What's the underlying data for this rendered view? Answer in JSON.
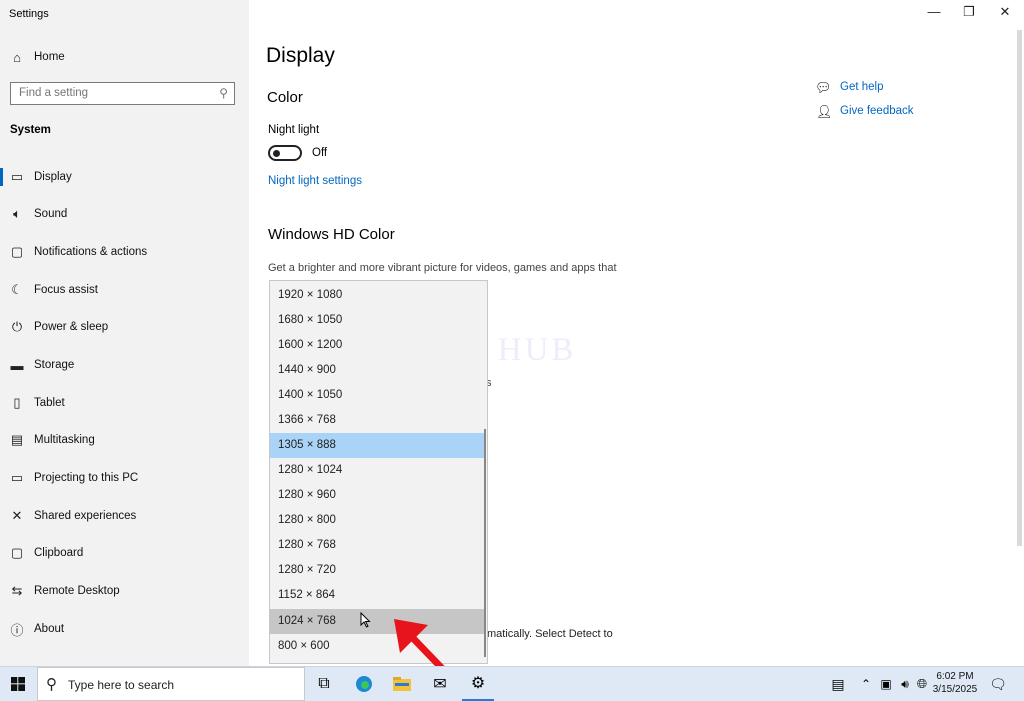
{
  "window": {
    "title": "Settings",
    "minimize": "—",
    "maximize": "❐",
    "close": "✕"
  },
  "sidebar": {
    "home": "Home",
    "search_placeholder": "Find a setting",
    "section": "System",
    "items": [
      {
        "label": "Display",
        "icon": "monitor-icon"
      },
      {
        "label": "Sound",
        "icon": "speaker-icon"
      },
      {
        "label": "Notifications & actions",
        "icon": "notification-icon"
      },
      {
        "label": "Focus assist",
        "icon": "moon-icon"
      },
      {
        "label": "Power & sleep",
        "icon": "power-icon"
      },
      {
        "label": "Storage",
        "icon": "storage-icon"
      },
      {
        "label": "Tablet",
        "icon": "tablet-icon"
      },
      {
        "label": "Multitasking",
        "icon": "multitasking-icon"
      },
      {
        "label": "Projecting to this PC",
        "icon": "projector-icon"
      },
      {
        "label": "Shared experiences",
        "icon": "share-icon"
      },
      {
        "label": "Clipboard",
        "icon": "clipboard-icon"
      },
      {
        "label": "Remote Desktop",
        "icon": "remote-icon"
      },
      {
        "label": "About",
        "icon": "info-icon"
      }
    ]
  },
  "main": {
    "page_title": "Display",
    "color_heading": "Color",
    "night_light_label": "Night light",
    "night_light_state": "Off",
    "night_light_settings": "Night light settings",
    "hd_heading": "Windows HD Color",
    "hd_desc": "Get a brighter and more vibrant picture for videos, games and apps that",
    "partial_line": "matically. Select Detect to",
    "get_help": "Get help",
    "give_feedback": "Give feedback"
  },
  "dropdown": {
    "options": [
      "1920 × 1080",
      "1680 × 1050",
      "1600 × 1200",
      "1440 × 900",
      "1400 × 1050",
      "1366 × 768",
      "1305 × 888",
      "1280 × 1024",
      "1280 × 960",
      "1280 × 800",
      "1280 × 768",
      "1280 × 720",
      "1152 × 864",
      "1024 × 768",
      "800 × 600"
    ],
    "selected": "1305 × 888",
    "hovered": "1024 × 768"
  },
  "watermark": "IT Pros HUB",
  "taskbar": {
    "search_text": "Type here to search",
    "time": "6:02 PM",
    "date": "3/15/2025"
  },
  "colors": {
    "accent": "#0067c0",
    "selected_option": "#a9d3f7",
    "hover_option": "#c6c6c6",
    "arrow": "#e8141b"
  }
}
